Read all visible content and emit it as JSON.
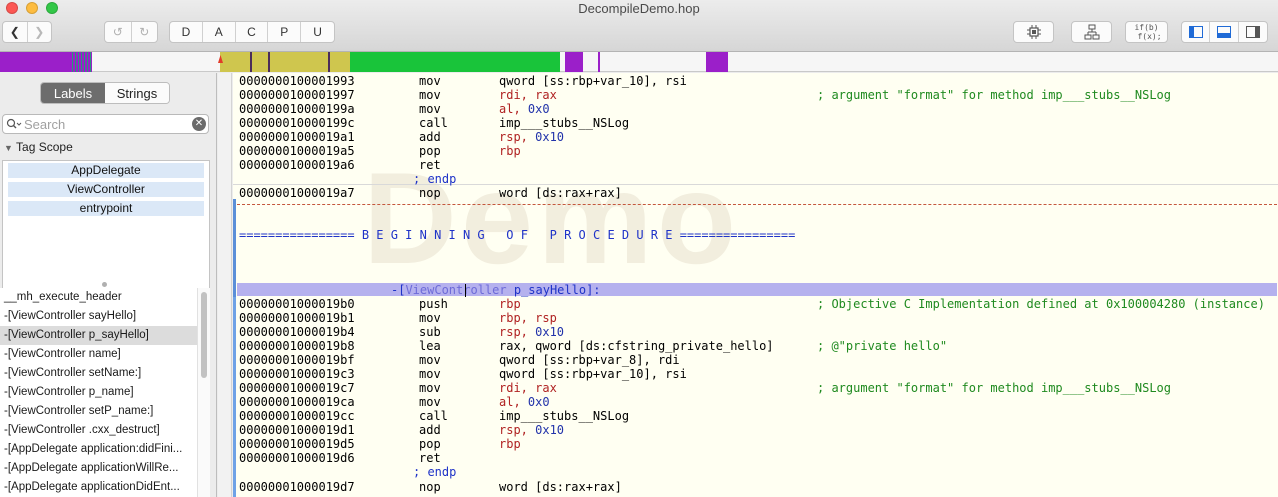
{
  "window": {
    "title": "DecompileDemo.hop"
  },
  "toolbar": {
    "back_icon": "chevron-left-icon",
    "forward_icon": "chevron-right-icon",
    "undo_icon": "undo-icon",
    "redo_icon": "redo-icon",
    "modes": [
      "D",
      "A",
      "C",
      "P",
      "U"
    ],
    "cpu_icon": "chip-icon",
    "flow_icon": "flowchart-icon",
    "pseudo_line1": "if(b)",
    "pseudo_line2": "f(x);",
    "layout_icons": [
      "left-panel-icon",
      "bottom-panel-icon",
      "right-panel-icon"
    ]
  },
  "navbar_colors": {
    "purple": "#9b1fc9",
    "olive": "#cfc64e",
    "green": "#19c43a",
    "teal": "#2a9a7a"
  },
  "sidebar": {
    "tabs": [
      "Labels",
      "Strings"
    ],
    "active_tab": "Labels",
    "search_placeholder": "Search",
    "tag_scope": "Tag Scope",
    "tags": [
      "AppDelegate",
      "ViewController",
      "entrypoint"
    ],
    "labels": [
      "__mh_execute_header",
      "-[ViewController sayHello]",
      "-[ViewController p_sayHello]",
      "-[ViewController name]",
      "-[ViewController setName:]",
      "-[ViewController p_name]",
      "-[ViewController setP_name:]",
      "-[ViewController .cxx_destruct]",
      "-[AppDelegate application:didFini...",
      "-[AppDelegate applicationWillRe...",
      "-[AppDelegate applicationDidEnt..."
    ],
    "selected_label_index": 2
  },
  "code": {
    "watermark": "Demo",
    "lines_top": [
      {
        "addr": "0000000100001993",
        "mn": "mov",
        "ops": [
          [
            "qword [ss:rbp+var_10], rsi",
            ""
          ]
        ],
        "comment": ""
      },
      {
        "addr": "0000000100001997",
        "mn": "mov",
        "ops": [
          [
            "rdi, rax",
            "reg"
          ]
        ],
        "comment": "; argument \"format\" for method imp___stubs__NSLog"
      },
      {
        "addr": "000000010000199a",
        "mn": "mov",
        "ops": [
          [
            "al, ",
            "reg"
          ],
          [
            "0x0",
            "num"
          ]
        ],
        "comment": ""
      },
      {
        "addr": "000000010000199c",
        "mn": "call",
        "ops": [
          [
            "imp___stubs__NSLog",
            ""
          ]
        ],
        "comment": ""
      },
      {
        "addr": "00000001000019a1",
        "mn": "add",
        "ops": [
          [
            "rsp, ",
            "reg"
          ],
          [
            "0x10",
            "num"
          ]
        ],
        "comment": ""
      },
      {
        "addr": "00000001000019a5",
        "mn": "pop",
        "ops": [
          [
            "rbp",
            "reg"
          ]
        ],
        "comment": ""
      },
      {
        "addr": "00000001000019a6",
        "mn": "ret",
        "ops": [],
        "comment": ""
      }
    ],
    "endp": "; endp",
    "nop_line": {
      "addr": "00000001000019a7",
      "mn": "nop",
      "op": "word [ds:rax+rax]"
    },
    "procedure_banner": "================ B E G I N N I N G   O F   P R O C E D U R E ================",
    "proc_name_prefix": "-[",
    "proc_class": "ViewController",
    "proc_method": " p_sayHello]:",
    "lines_bottom": [
      {
        "addr": "00000001000019b0",
        "mn": "push",
        "ops": [
          [
            "rbp",
            "reg"
          ]
        ],
        "comment": "; Objective C Implementation defined at 0x100004280 (instance)"
      },
      {
        "addr": "00000001000019b1",
        "mn": "mov",
        "ops": [
          [
            "rbp, rsp",
            "reg"
          ]
        ],
        "comment": ""
      },
      {
        "addr": "00000001000019b4",
        "mn": "sub",
        "ops": [
          [
            "rsp, ",
            "reg"
          ],
          [
            "0x10",
            "num"
          ]
        ],
        "comment": ""
      },
      {
        "addr": "00000001000019b8",
        "mn": "lea",
        "ops": [
          [
            "rax, qword [ds:cfstring_private_hello]",
            ""
          ]
        ],
        "comment": "; @\"private hello\""
      },
      {
        "addr": "00000001000019bf",
        "mn": "mov",
        "ops": [
          [
            "qword [ss:rbp+var_8], rdi",
            ""
          ]
        ],
        "comment": ""
      },
      {
        "addr": "00000001000019c3",
        "mn": "mov",
        "ops": [
          [
            "qword [ss:rbp+var_10], rsi",
            ""
          ]
        ],
        "comment": ""
      },
      {
        "addr": "00000001000019c7",
        "mn": "mov",
        "ops": [
          [
            "rdi, rax",
            "reg"
          ]
        ],
        "comment": "; argument \"format\" for method imp___stubs__NSLog"
      },
      {
        "addr": "00000001000019ca",
        "mn": "mov",
        "ops": [
          [
            "al, ",
            "reg"
          ],
          [
            "0x0",
            "num"
          ]
        ],
        "comment": ""
      },
      {
        "addr": "00000001000019cc",
        "mn": "call",
        "ops": [
          [
            "imp___stubs__NSLog",
            ""
          ]
        ],
        "comment": ""
      },
      {
        "addr": "00000001000019d1",
        "mn": "add",
        "ops": [
          [
            "rsp, ",
            "reg"
          ],
          [
            "0x10",
            "num"
          ]
        ],
        "comment": ""
      },
      {
        "addr": "00000001000019d5",
        "mn": "pop",
        "ops": [
          [
            "rbp",
            "reg"
          ]
        ],
        "comment": ""
      },
      {
        "addr": "00000001000019d6",
        "mn": "ret",
        "ops": [],
        "comment": ""
      }
    ],
    "endp2": "; endp",
    "nop_line2": {
      "addr": "00000001000019d7",
      "mn": "nop",
      "op": "word [ds:rax+rax]"
    }
  }
}
